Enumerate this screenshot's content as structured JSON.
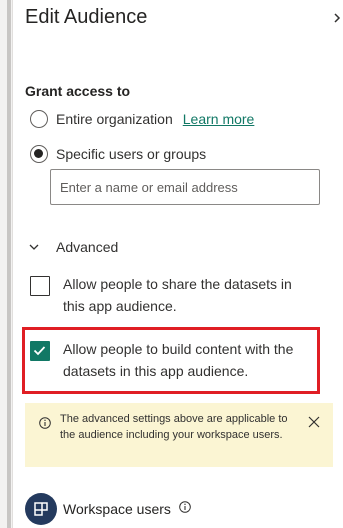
{
  "panel": {
    "title": "Edit Audience"
  },
  "grant_access": {
    "label": "Grant access to",
    "options": [
      {
        "label": "Entire organization",
        "selected": false
      },
      {
        "label": "Specific users or groups",
        "selected": true
      }
    ],
    "learn_more": "Learn more",
    "search_placeholder": "Enter a name or email address"
  },
  "advanced": {
    "label": "Advanced",
    "expanded": true,
    "options": [
      {
        "label": "Allow people to share the datasets in this app audience.",
        "checked": false
      },
      {
        "label": "Allow people to build content with the datasets in this app audience.",
        "checked": true
      }
    ]
  },
  "info_bar": {
    "text": "The advanced settings above are applicable to the audience including your workspace users."
  },
  "workspace": {
    "label": "Workspace users"
  },
  "icons": {
    "collapse": "chevron-right-icon",
    "advanced_toggle": "chevron-down-icon",
    "info": "info-icon",
    "dismiss": "close-icon",
    "avatar": "workspace-icon",
    "workspace_info": "info-icon"
  },
  "colors": {
    "accent": "#117865",
    "highlight": "#e01e24",
    "info_background": "#fbf5d3",
    "avatar_background": "#243a5e"
  }
}
